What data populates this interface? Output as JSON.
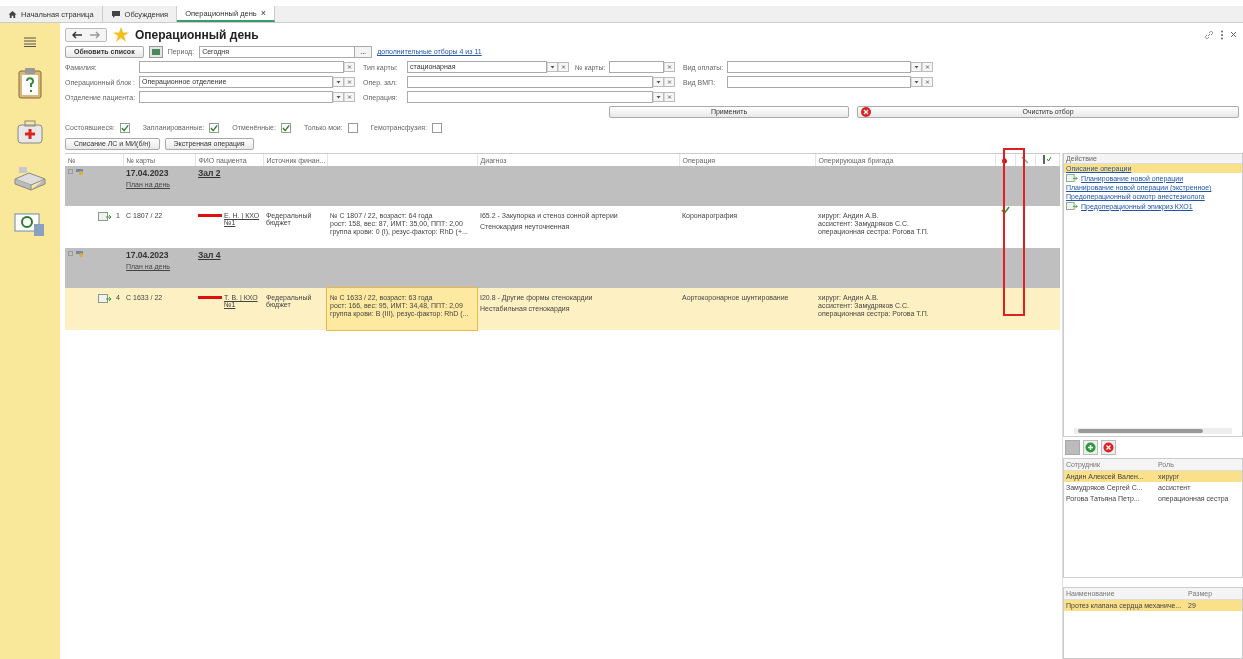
{
  "tabs": [
    {
      "kind": "home",
      "label": "Начальная страница",
      "selected": false
    },
    {
      "kind": "chat",
      "label": "Обсуждения",
      "selected": false
    },
    {
      "kind": "doc",
      "label": "Операционный день",
      "close": "×",
      "selected": true
    }
  ],
  "form": {
    "title": "Операционный день",
    "refresh_button": "Обновить список",
    "period_label": "Период:",
    "period_value": "Сегодня",
    "period_button": "...",
    "extra_filters_link": "дополнительные отборы 4 из 11",
    "fields": [
      [
        {
          "label": "Фамилия:",
          "dropdown": false
        },
        {
          "label": "Тип карты:",
          "value": "стационарная",
          "dropdown": true
        },
        {
          "label": "№ карты:",
          "dropdown": false
        },
        {
          "label": "Вид оплаты:",
          "dropdown": true
        }
      ],
      [
        {
          "label": "Операционный блок :",
          "value": "Операционное отделение",
          "dropdown": true
        },
        {
          "label": "Опер. зал:",
          "dropdown": true
        },
        {
          "label": "Вид ВМП:",
          "dropdown": true
        }
      ],
      [
        {
          "label": "Отделение пациента:",
          "dropdown": true
        },
        {
          "label": "Операция:",
          "dropdown": true
        }
      ]
    ],
    "apply_button": "Применить",
    "clear_button": "Очистить отбор",
    "checkboxes": [
      {
        "label": "Состоявшиеся:",
        "checked": true
      },
      {
        "label": "Запланированные:",
        "checked": true
      },
      {
        "label": "Отменённые:",
        "checked": true
      },
      {
        "label": "Только мои:",
        "checked": false
      },
      {
        "label": "Гемотрансфузия:",
        "checked": false
      }
    ],
    "action_buttons": [
      "Списание ЛС и МИ(б/н)",
      "Экстренная операция"
    ]
  },
  "table": {
    "columns": [
      "№",
      "№ карты",
      "ФИО пациента",
      "Источник финан...",
      "",
      "Диагноз",
      "Операция",
      "Оперирующая бригада"
    ],
    "groups": [
      {
        "date": "17.04.2023",
        "room": "Зал 2",
        "plan_link": "План на день",
        "rows": [
          {
            "num": "1",
            "card": "С 1807 / 22",
            "patient": "Е. Н. | КХО №1",
            "source": "Федеральный бюджет",
            "info": [
              "№ С 1807 / 22, возраст: 64 года",
              "рост: 158, вес: 87, ИМТ: 35,00, ППТ: 2,00",
              "группа крови: 0 (I), резус-фактор: RhD (+..."
            ],
            "diagnosis": [
              "I65.2 - Закупорка и стеноз сонной артерии",
              "Стенокардия неуточненная"
            ],
            "operation": "Коронарография",
            "team": [
              "хирург: Андин А.В.",
              "ассистент: Замудряков С.С.",
              "операционная сестра: Рогова Т.П."
            ],
            "done": true,
            "selected": false
          }
        ]
      },
      {
        "date": "17.04.2023",
        "room": "Зал 4",
        "plan_link": "План на день",
        "rows": [
          {
            "num": "4",
            "card": "С 1633 / 22",
            "patient": "Т. В. | КХО №1",
            "source": "Федеральный бюджет",
            "info": [
              "№ С 1633 / 22, возраст: 63 года",
              "рост: 166, вес: 95, ИМТ: 34,48, ППТ: 2,09",
              "группа крови: B (III), резус-фактор: RhD (..."
            ],
            "diagnosis": [
              "I20.8 - Другие формы стенокардии",
              "Нестабильная стенокардия"
            ],
            "operation": "Аортокоронарное шунтирование",
            "team": [
              "хирург: Андин А.В.",
              "ассистент: Замудряков С.С.",
              "операционная сестра: Рогова Т.П."
            ],
            "done": false,
            "selected": true
          }
        ]
      }
    ]
  },
  "actions": {
    "header": "Действие",
    "items": [
      {
        "label": "Описание операции",
        "icon": false,
        "selected": true
      },
      {
        "label": "Планирование новой операции",
        "icon": true,
        "selected": false
      },
      {
        "label": "Планирование новой операции (экстренное)",
        "icon": false,
        "selected": false
      },
      {
        "label": "Предоперационный осмотр анестезиолога",
        "icon": false,
        "selected": false
      },
      {
        "label": "Предоперационный эпикриз КХО1",
        "icon": true,
        "selected": false
      }
    ]
  },
  "staff": {
    "columns": [
      "Сотрудник",
      "Роль"
    ],
    "rows": [
      {
        "name": "Андин Алексей Вален...",
        "role": "хирург",
        "selected": true
      },
      {
        "name": "Замудряков Сергей С...",
        "role": "ассистент",
        "selected": false
      },
      {
        "name": "Рогова Татьяна Петр...",
        "role": "операционная сестра",
        "selected": false
      }
    ]
  },
  "items": {
    "columns": [
      "Наименование",
      "Размер"
    ],
    "rows": [
      {
        "name": "Протез клапана сердца механиче...",
        "size": "29",
        "selected": true
      }
    ]
  }
}
